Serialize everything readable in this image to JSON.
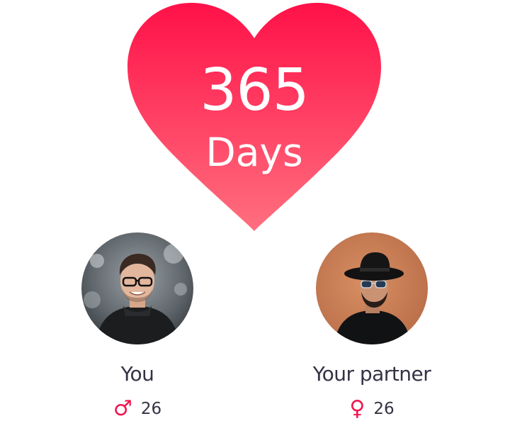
{
  "counter": {
    "number": "365",
    "unit": "Days"
  },
  "colors": {
    "heart_top": "#ff1148",
    "heart_bottom": "#ff6f7f",
    "accent": "#f0164e",
    "text": "#333344"
  },
  "people": {
    "you": {
      "name": "You",
      "gender_symbol": "♂",
      "gender_icon": "male-icon",
      "age": "26"
    },
    "partner": {
      "name": "Your partner",
      "gender_symbol": "♀",
      "gender_icon": "female-icon",
      "age": "26"
    }
  }
}
